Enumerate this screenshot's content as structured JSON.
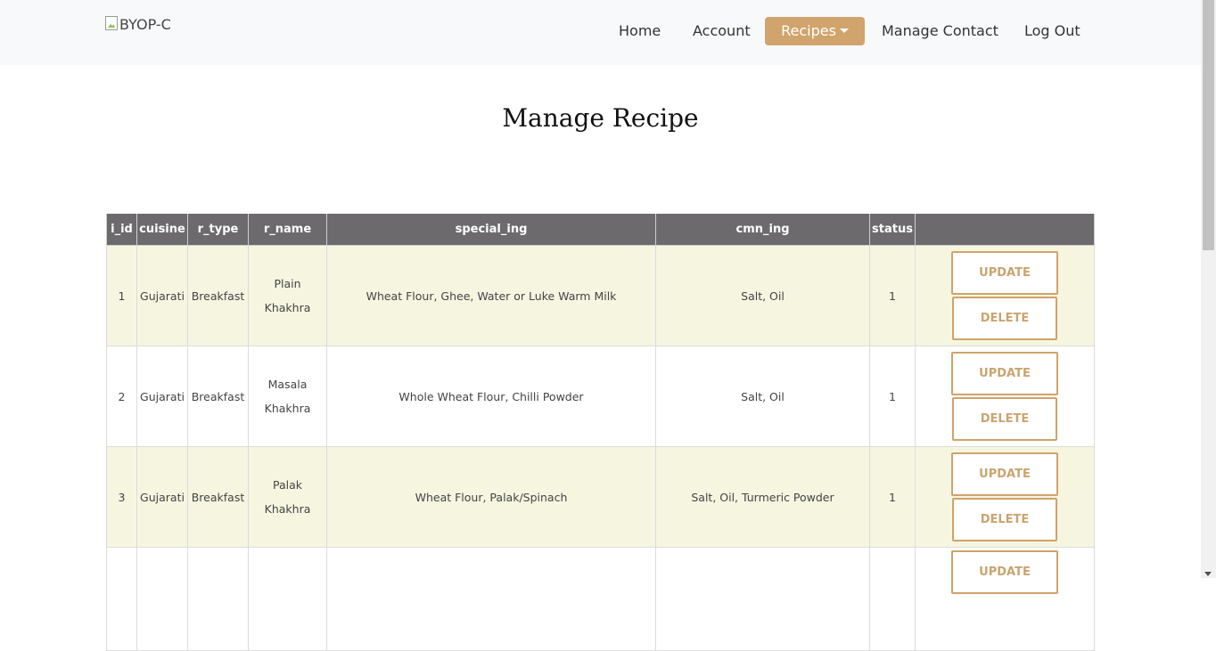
{
  "nav": {
    "logo_alt": "BYOP-C",
    "items": [
      {
        "label": "Home"
      },
      {
        "label": "Account"
      },
      {
        "label": "Recipes"
      },
      {
        "label": "Manage Contact"
      },
      {
        "label": "Log Out"
      }
    ],
    "active_color": "#d0a46c"
  },
  "page": {
    "title": "Manage Recipe"
  },
  "table": {
    "headers": [
      "i_id",
      "cuisine",
      "r_type",
      "r_name",
      "special_ing",
      "cmn_ing",
      "status",
      ""
    ],
    "rows": [
      {
        "i_id": "1",
        "cuisine": "Gujarati",
        "r_type": "Breakfast",
        "r_name_1": "Plain",
        "r_name_2": "Khakhra",
        "special_ing": "Wheat Flour, Ghee, Water or Luke Warm Milk",
        "cmn_ing": "Salt, Oil",
        "status": "1"
      },
      {
        "i_id": "2",
        "cuisine": "Gujarati",
        "r_type": "Breakfast",
        "r_name_1": "Masala",
        "r_name_2": "Khakhra",
        "special_ing": "Whole Wheat Flour, Chilli Powder",
        "cmn_ing": "Salt, Oil",
        "status": "1"
      },
      {
        "i_id": "3",
        "cuisine": "Gujarati",
        "r_type": "Breakfast",
        "r_name_1": "Palak",
        "r_name_2": "Khakhra",
        "special_ing": "Wheat Flour, Palak/Spinach",
        "cmn_ing": "Salt, Oil, Turmeric Powder",
        "status": "1"
      }
    ],
    "update_label": "UPDATE",
    "delete_label": "DELETE"
  }
}
